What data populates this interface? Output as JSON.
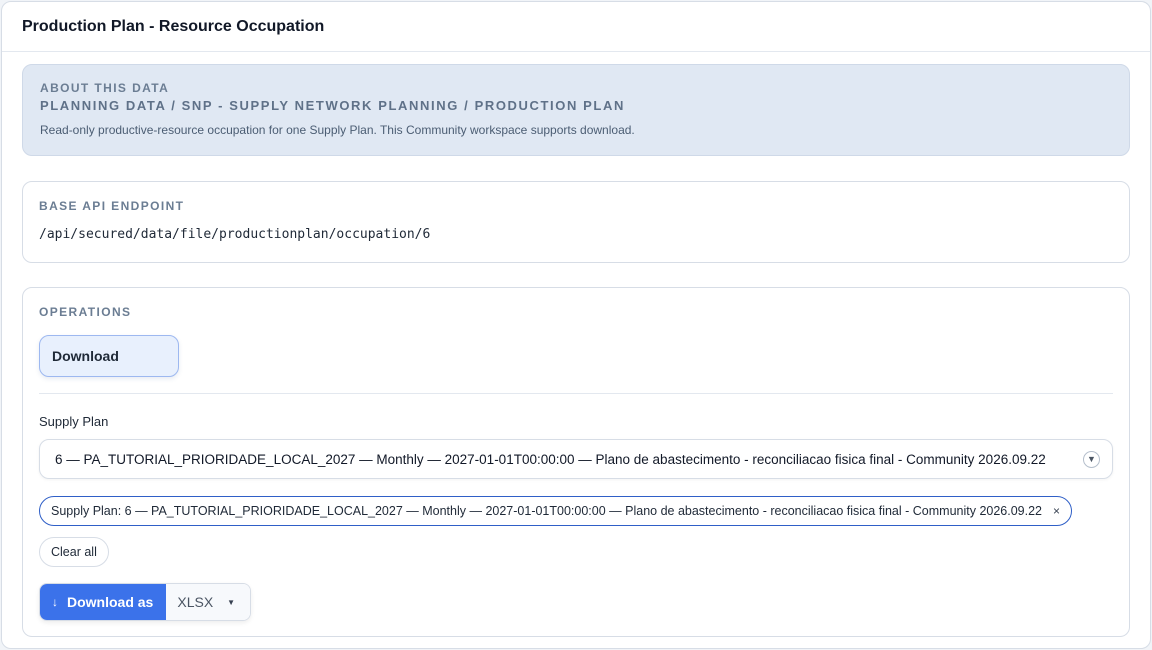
{
  "header": {
    "title": "Production Plan - Resource Occupation"
  },
  "about": {
    "eyebrow": "About this data",
    "path": "Planning Data / SNP - Supply Network Planning / Production Plan",
    "description": "Read-only productive-resource occupation for one Supply Plan. This Community workspace supports download."
  },
  "endpoint": {
    "label": "Base API endpoint",
    "value": "/api/secured/data/file/productionplan/occupation/6"
  },
  "operations": {
    "label": "Operations",
    "download_label": "Download",
    "supply_plan": {
      "label": "Supply Plan",
      "selected": "6 — PA_TUTORIAL_PRIORIDADE_LOCAL_2027 — Monthly — 2027-01-01T00:00:00 — Plano de abastecimento - reconciliacao fisica final - Community 2026.09.22",
      "chevron_icon": "chevron-down-icon"
    },
    "filter_chip": {
      "text": "Supply Plan: 6 — PA_TUTORIAL_PRIORIDADE_LOCAL_2027 — Monthly — 2027-01-01T00:00:00 — Plano de abastecimento - reconciliacao fisica final - Community 2026.09.22",
      "remove_symbol": "×"
    },
    "clear_all_label": "Clear all",
    "download_as": {
      "arrow": "↓",
      "label": "Download as",
      "format": "XLSX",
      "caret": "▼"
    }
  },
  "colors": {
    "accent": "#3b72ea",
    "about_bg": "#e0e8f3",
    "chip_border": "#2f5fc7"
  }
}
